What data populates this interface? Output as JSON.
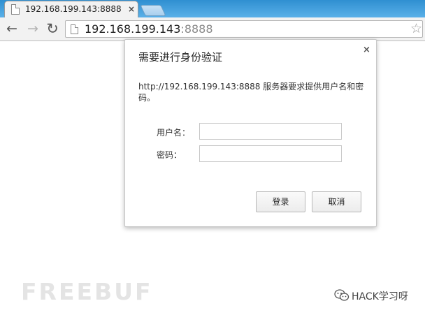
{
  "browser": {
    "tab": {
      "title": "192.168.199.143:8888",
      "close_glyph": "×"
    },
    "toolbar": {
      "back_glyph": "←",
      "forward_glyph": "→",
      "reload_glyph": "↻",
      "url_host": "192.168.199.143",
      "url_port": ":8888",
      "star_glyph": "☆"
    }
  },
  "dialog": {
    "title": "需要进行身份验证",
    "close_glyph": "×",
    "message": "http://192.168.199.143:8888 服务器要求提供用户名和密码。",
    "username_label": "用户名：",
    "password_label": "密码：",
    "username_value": "",
    "password_value": "",
    "login_label": "登录",
    "cancel_label": "取消"
  },
  "watermark": {
    "site": "FREEBUF",
    "account": "HACK学习呀"
  },
  "icons": {
    "tab_favicon": "page-icon",
    "omnibox_icon": "page-icon",
    "wechat": "wechat-icon"
  }
}
